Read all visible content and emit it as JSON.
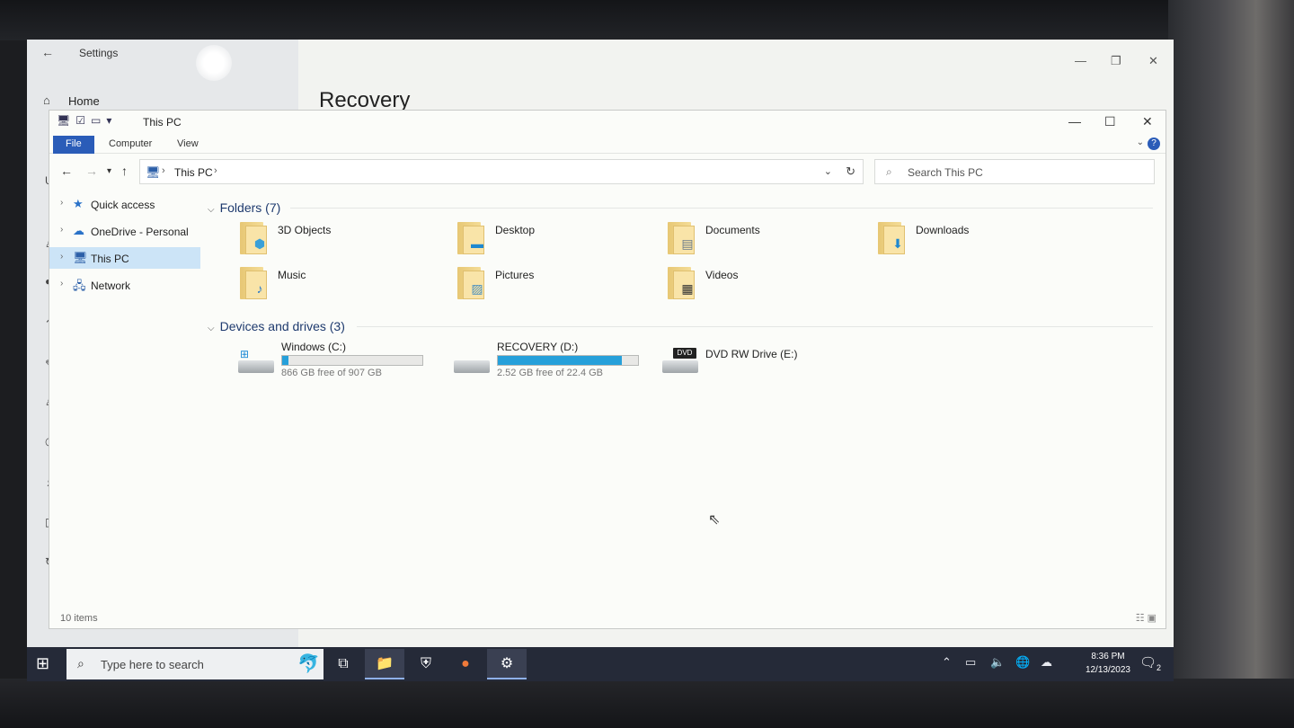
{
  "settings": {
    "title": "Settings",
    "back_icon": "back-arrow-icon",
    "home_label": "Home",
    "page_heading": "Recovery",
    "controls": {
      "minimize": "—",
      "maximize": "❐",
      "close": "✕"
    }
  },
  "explorer": {
    "title": "This PC",
    "controls": {
      "minimize": "—",
      "maximize": "☐",
      "close": "✕"
    },
    "ribbon": {
      "tabs": [
        "File",
        "Computer",
        "View"
      ],
      "help": "?"
    },
    "address": {
      "crumb": "This PC",
      "dropdown": "⌄",
      "refresh": "↻"
    },
    "search": {
      "placeholder": "Search This PC"
    },
    "nav": {
      "items": [
        {
          "label": "Quick access",
          "icon": "star-icon",
          "glyph": "★",
          "color": "#2a72c8"
        },
        {
          "label": "OneDrive - Personal",
          "icon": "cloud-icon",
          "glyph": "☁",
          "color": "#2a72c8"
        },
        {
          "label": "This PC",
          "icon": "computer-icon",
          "glyph": "🖥",
          "color": "#2c5fa8",
          "selected": true
        },
        {
          "label": "Network",
          "icon": "network-icon",
          "glyph": "🖧",
          "color": "#2c5fa8"
        }
      ]
    },
    "folders_group": {
      "header": "Folders (7)",
      "items": [
        {
          "name": "3D Objects",
          "badge": "⬢",
          "badge_color": "#3aa0d8"
        },
        {
          "name": "Desktop",
          "badge": "▬",
          "badge_color": "#1e88d0"
        },
        {
          "name": "Documents",
          "badge": "▤",
          "badge_color": "#6a7a8a"
        },
        {
          "name": "Downloads",
          "badge": "⬇",
          "badge_color": "#1e88d0"
        },
        {
          "name": "Music",
          "badge": "♪",
          "badge_color": "#2a7ac8"
        },
        {
          "name": "Pictures",
          "badge": "▨",
          "badge_color": "#4a90c0"
        },
        {
          "name": "Videos",
          "badge": "▦",
          "badge_color": "#333"
        }
      ]
    },
    "drives_group": {
      "header": "Devices and drives (3)",
      "items": [
        {
          "name": "Windows (C:)",
          "free": "866 GB free of 907 GB",
          "used_fraction": 0.045,
          "type": "windows"
        },
        {
          "name": "RECOVERY (D:)",
          "free": "2.52 GB free of 22.4 GB",
          "used_fraction": 0.887,
          "type": "drive"
        },
        {
          "name": "DVD RW Drive (E:)",
          "type": "dvd",
          "dvd_label": "DVD"
        }
      ]
    },
    "status": {
      "count": "10 items"
    }
  },
  "taskbar": {
    "search_placeholder": "Type here to search",
    "clock_time": "8:36 PM",
    "clock_date": "12/13/2023",
    "notification_count": "2"
  }
}
